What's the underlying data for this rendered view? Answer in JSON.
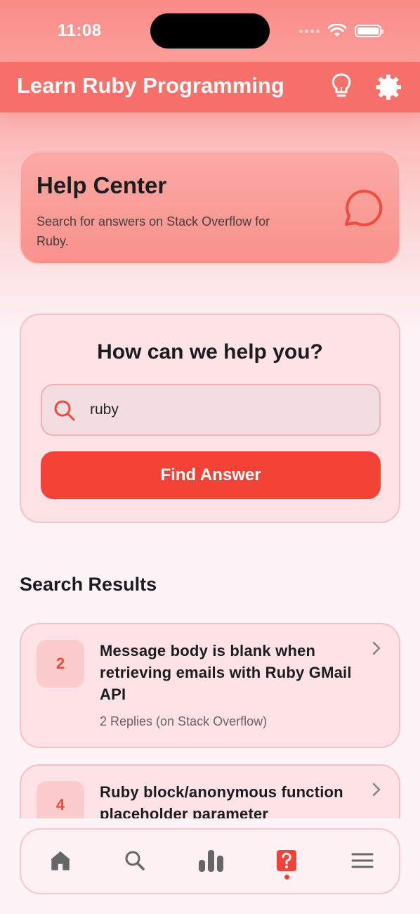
{
  "status_bar": {
    "time": "11:08"
  },
  "app_bar": {
    "title": "Learn Ruby Programming"
  },
  "help_center": {
    "title": "Help Center",
    "description": "Search for answers on Stack Overflow for Ruby."
  },
  "search": {
    "heading": "How can we help you?",
    "query": "ruby",
    "button_label": "Find Answer"
  },
  "results": {
    "title": "Search Results",
    "items": [
      {
        "count": "2",
        "title": "Message body is blank when retrieving emails with Ruby GMail API",
        "meta": "2 Replies (on Stack Overflow)"
      },
      {
        "count": "4",
        "title": "Ruby block/anonymous function placeholder parameter",
        "meta": ""
      }
    ]
  },
  "colors": {
    "accent": "#f54236",
    "app_bar": "#f7716a",
    "card": "#fde2e6"
  },
  "bottom_nav": {
    "items": [
      "home-icon",
      "search-icon",
      "stats-icon",
      "help-icon",
      "menu-icon"
    ],
    "active": "help-icon"
  }
}
